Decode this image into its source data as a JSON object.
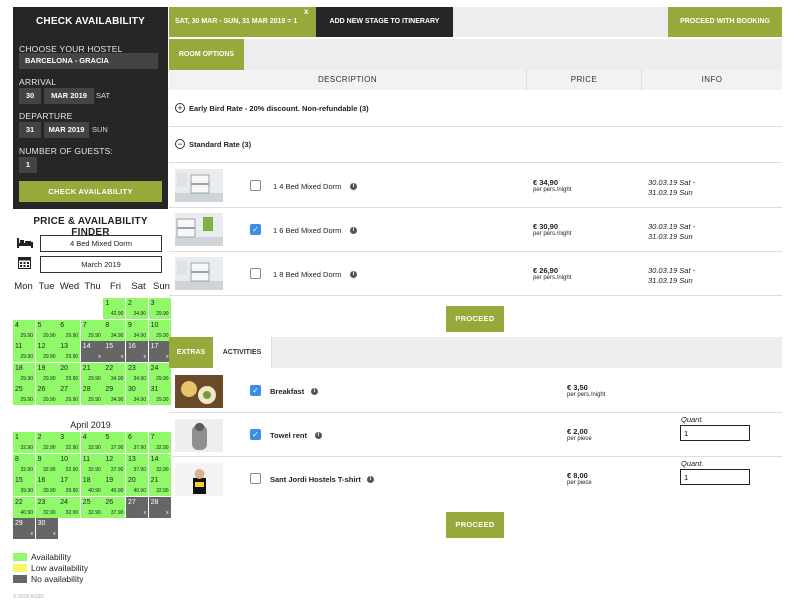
{
  "left_panel": {
    "title": "CHECK AVAILABILITY",
    "hostel_label": "CHOOSE YOUR HOSTEL",
    "hostel_value": "BARCELONA - GRACIA",
    "arrival_label": "ARRIVAL",
    "arrival_day": "30",
    "arrival_month": "MAR 2019",
    "arrival_weekday": "SAT",
    "departure_label": "DEPARTURE",
    "departure_day": "31",
    "departure_month": "MAR 2019",
    "departure_weekday": "SUN",
    "guests_label": "NUMBER OF GUESTS:",
    "guests_value": "1",
    "check_button": "CHECK AVAILABILITY"
  },
  "finder": {
    "title": "PRICE & AVAILABILITY FINDER",
    "room_icon": "bed-icon",
    "room_value": "4 Bed Mixed Dorm",
    "month_icon": "calendar-icon",
    "month_value": "March 2019",
    "weekdays": [
      "Mon",
      "Tue",
      "Wed",
      "Thu",
      "Fri",
      "Sat",
      "Sun"
    ],
    "march": [
      {
        "day": "1",
        "price": "42.90",
        "status": "available"
      },
      {
        "day": "2",
        "price": "34.90",
        "status": "available"
      },
      {
        "day": "3",
        "price": "29.90",
        "status": "available"
      },
      {
        "day": "4",
        "price": "29.90",
        "status": "available"
      },
      {
        "day": "5",
        "price": "29.90",
        "status": "available"
      },
      {
        "day": "6",
        "price": "29.90",
        "status": "available"
      },
      {
        "day": "7",
        "price": "29.90",
        "status": "available"
      },
      {
        "day": "8",
        "price": "34.90",
        "status": "available"
      },
      {
        "day": "9",
        "price": "34.90",
        "status": "available"
      },
      {
        "day": "10",
        "price": "29.90",
        "status": "available"
      },
      {
        "day": "11",
        "price": "29.90",
        "status": "available"
      },
      {
        "day": "12",
        "price": "29.90",
        "status": "available"
      },
      {
        "day": "13",
        "price": "29.90",
        "status": "available"
      },
      {
        "day": "14",
        "price": "x",
        "status": "none"
      },
      {
        "day": "15",
        "price": "x",
        "status": "none"
      },
      {
        "day": "16",
        "price": "x",
        "status": "none"
      },
      {
        "day": "17",
        "price": "x",
        "status": "none"
      },
      {
        "day": "18",
        "price": "29.90",
        "status": "available"
      },
      {
        "day": "19",
        "price": "29.90",
        "status": "available"
      },
      {
        "day": "20",
        "price": "29.90",
        "status": "available"
      },
      {
        "day": "21",
        "price": "29.90",
        "status": "available"
      },
      {
        "day": "22",
        "price": "34.90",
        "status": "available"
      },
      {
        "day": "23",
        "price": "34.90",
        "status": "available"
      },
      {
        "day": "24",
        "price": "29.90",
        "status": "available"
      },
      {
        "day": "25",
        "price": "29.90",
        "status": "available"
      },
      {
        "day": "26",
        "price": "29.90",
        "status": "available"
      },
      {
        "day": "27",
        "price": "29.90",
        "status": "available"
      },
      {
        "day": "28",
        "price": "29.90",
        "status": "available"
      },
      {
        "day": "29",
        "price": "34.90",
        "status": "available"
      },
      {
        "day": "30",
        "price": "34.90",
        "status": "available"
      },
      {
        "day": "31",
        "price": "29.90",
        "status": "available"
      }
    ],
    "april_title": "April 2019",
    "april": [
      {
        "day": "1",
        "price": "32.90",
        "status": "available"
      },
      {
        "day": "2",
        "price": "32.90",
        "status": "available"
      },
      {
        "day": "3",
        "price": "32.90",
        "status": "available"
      },
      {
        "day": "4",
        "price": "32.90",
        "status": "available"
      },
      {
        "day": "5",
        "price": "37.90",
        "status": "available"
      },
      {
        "day": "6",
        "price": "37.90",
        "status": "available"
      },
      {
        "day": "7",
        "price": "32.90",
        "status": "available"
      },
      {
        "day": "8",
        "price": "32.90",
        "status": "available"
      },
      {
        "day": "9",
        "price": "32.90",
        "status": "available"
      },
      {
        "day": "10",
        "price": "32.90",
        "status": "available"
      },
      {
        "day": "11",
        "price": "32.90",
        "status": "available"
      },
      {
        "day": "12",
        "price": "37.90",
        "status": "available"
      },
      {
        "day": "13",
        "price": "37.90",
        "status": "available"
      },
      {
        "day": "14",
        "price": "32.90",
        "status": "available"
      },
      {
        "day": "15",
        "price": "39.90",
        "status": "available"
      },
      {
        "day": "16",
        "price": "39.90",
        "status": "available"
      },
      {
        "day": "17",
        "price": "39.90",
        "status": "available"
      },
      {
        "day": "18",
        "price": "40.90",
        "status": "available"
      },
      {
        "day": "19",
        "price": "40.90",
        "status": "available"
      },
      {
        "day": "20",
        "price": "40.90",
        "status": "available"
      },
      {
        "day": "21",
        "price": "32.90",
        "status": "available"
      },
      {
        "day": "22",
        "price": "40.90",
        "status": "available"
      },
      {
        "day": "23",
        "price": "32.90",
        "status": "available"
      },
      {
        "day": "24",
        "price": "32.90",
        "status": "available"
      },
      {
        "day": "25",
        "price": "32.90",
        "status": "available"
      },
      {
        "day": "26",
        "price": "37.90",
        "status": "available"
      },
      {
        "day": "27",
        "price": "x",
        "status": "none"
      },
      {
        "day": "28",
        "price": "x",
        "status": "none"
      },
      {
        "day": "29",
        "price": "x",
        "status": "none"
      },
      {
        "day": "30",
        "price": "x",
        "status": "none"
      }
    ],
    "legend": [
      {
        "label": "Availability",
        "color": "#8ff96a"
      },
      {
        "label": "Low availability",
        "color": "#f7f56b"
      },
      {
        "label": "No availability",
        "color": "#666666"
      }
    ],
    "copyright": "© 2018 ASSD"
  },
  "top_bar": {
    "stage_label": "SAT, 30 MAR - SUN, 31 MAR 2019 = 1",
    "stage_close": "x",
    "add_stage": "ADD NEW STAGE TO ITINERARY",
    "proceed_booking": "PROCEED WITH BOOKING"
  },
  "room_tab": "ROOM OPTIONS",
  "columns": [
    "DESCRIPTION",
    "PRICE",
    "INFO"
  ],
  "rates": [
    {
      "toggle": "+",
      "title": "Early Bird Rate - 20% discount. Non-refundable (3)"
    },
    {
      "toggle": "−",
      "title": "Standard Rate (3)"
    }
  ],
  "rooms": [
    {
      "checked": false,
      "name": "1  4 Bed Mixed Dorm",
      "price": "€ 34,90",
      "price_unit": "per pers./night",
      "date1": "30.03.19  Sat -",
      "date2": "31.03.19  Sun"
    },
    {
      "checked": true,
      "name": "1  6 Bed Mixed Dorm",
      "price": "€ 30,90",
      "price_unit": "per pers./night",
      "date1": "30.03.19  Sat -",
      "date2": "31.03.19  Sun"
    },
    {
      "checked": false,
      "name": "1  8 Bed Mixed Dorm",
      "price": "€ 26,90",
      "price_unit": "per pers./night",
      "date1": "30.03.19  Sat -",
      "date2": "31.03.19  Sun"
    }
  ],
  "proceed": "PROCEED",
  "extras_tabs": [
    "EXTRAS",
    "ACTIVITIES"
  ],
  "extras": [
    {
      "checked": true,
      "name": "Breakfast",
      "price": "€ 3,50",
      "price_unit": "per pers./night",
      "quant_label": "",
      "quant": ""
    },
    {
      "checked": true,
      "name": "Towel rent",
      "price": "€ 2,00",
      "price_unit": "per piece",
      "quant_label": "Quant.",
      "quant": "1"
    },
    {
      "checked": false,
      "name": "Sant Jordi Hostels T-shirt",
      "price": "€ 8,00",
      "price_unit": "per piece",
      "quant_label": "Quant.",
      "quant": "1"
    }
  ],
  "colors": {
    "accent": "#97a93b",
    "dark": "#262626",
    "check": "#3a8ee6"
  }
}
